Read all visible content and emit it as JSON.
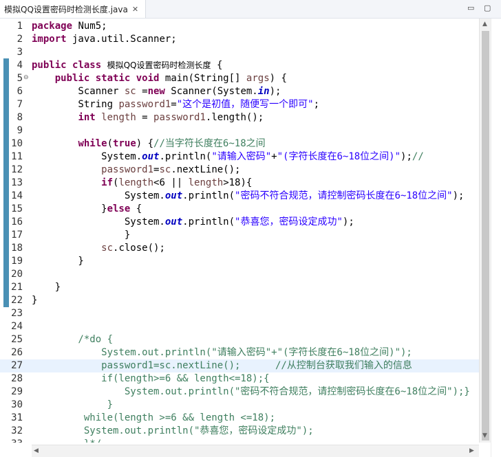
{
  "tab": {
    "title": "模拟QQ设置密码时检测长度.java",
    "close_glyph": "✕"
  },
  "window_controls": {
    "minimize": "▭",
    "maximize": "▢"
  },
  "editor": {
    "current_line": 27,
    "lines": [
      {
        "n": "1",
        "tokens": [
          {
            "t": "package",
            "c": "kw"
          },
          {
            "t": " Num5;"
          }
        ]
      },
      {
        "n": "2",
        "tokens": [
          {
            "t": "import",
            "c": "kw"
          },
          {
            "t": " java.util.Scanner;"
          }
        ]
      },
      {
        "n": "3",
        "tokens": []
      },
      {
        "n": "4",
        "tokens": [
          {
            "t": "public",
            "c": "kw"
          },
          {
            "t": " "
          },
          {
            "t": "class",
            "c": "kw"
          },
          {
            "t": " "
          },
          {
            "t": "模拟QQ设置密码时检测长度",
            "c": "cjk"
          },
          {
            "t": " {"
          }
        ]
      },
      {
        "n": "5",
        "fold": "⊖",
        "tokens": [
          {
            "t": "    "
          },
          {
            "t": "public",
            "c": "kw"
          },
          {
            "t": " "
          },
          {
            "t": "static",
            "c": "kw"
          },
          {
            "t": " "
          },
          {
            "t": "void",
            "c": "kw"
          },
          {
            "t": " main(String[] "
          },
          {
            "t": "args",
            "c": "var"
          },
          {
            "t": ") {"
          }
        ]
      },
      {
        "n": "6",
        "tokens": [
          {
            "t": "        Scanner "
          },
          {
            "t": "sc",
            "c": "var"
          },
          {
            "t": " ="
          },
          {
            "t": "new",
            "c": "kw"
          },
          {
            "t": " Scanner(System."
          },
          {
            "t": "in",
            "c": "fld"
          },
          {
            "t": ");"
          }
        ]
      },
      {
        "n": "7",
        "tokens": [
          {
            "t": "        String "
          },
          {
            "t": "password1",
            "c": "var"
          },
          {
            "t": "="
          },
          {
            "t": "\"这个是初值，随便写一个即可\"",
            "c": "str"
          },
          {
            "t": ";"
          }
        ]
      },
      {
        "n": "8",
        "tokens": [
          {
            "t": "        "
          },
          {
            "t": "int",
            "c": "kw"
          },
          {
            "t": " "
          },
          {
            "t": "length",
            "c": "var"
          },
          {
            "t": " = "
          },
          {
            "t": "password1",
            "c": "var"
          },
          {
            "t": ".length();"
          }
        ]
      },
      {
        "n": "9",
        "tokens": []
      },
      {
        "n": "10",
        "tokens": [
          {
            "t": "        "
          },
          {
            "t": "while",
            "c": "kw"
          },
          {
            "t": "("
          },
          {
            "t": "true",
            "c": "kw"
          },
          {
            "t": ") {"
          },
          {
            "t": "//当字符长度在6~18之间",
            "c": "cmt"
          }
        ]
      },
      {
        "n": "11",
        "tokens": [
          {
            "t": "            System."
          },
          {
            "t": "out",
            "c": "fld"
          },
          {
            "t": ".println("
          },
          {
            "t": "\"请输入密码\"",
            "c": "str"
          },
          {
            "t": "+"
          },
          {
            "t": "\"(字符长度在6~18位之间)\"",
            "c": "str"
          },
          {
            "t": ");"
          },
          {
            "t": "//",
            "c": "cmt"
          }
        ]
      },
      {
        "n": "12",
        "tokens": [
          {
            "t": "            "
          },
          {
            "t": "password1",
            "c": "var"
          },
          {
            "t": "="
          },
          {
            "t": "sc",
            "c": "var"
          },
          {
            "t": ".nextLine();"
          }
        ]
      },
      {
        "n": "13",
        "tokens": [
          {
            "t": "            "
          },
          {
            "t": "if",
            "c": "kw"
          },
          {
            "t": "("
          },
          {
            "t": "length",
            "c": "var"
          },
          {
            "t": "<6 || "
          },
          {
            "t": "length",
            "c": "var"
          },
          {
            "t": ">18){"
          }
        ]
      },
      {
        "n": "14",
        "tokens": [
          {
            "t": "                System."
          },
          {
            "t": "out",
            "c": "fld"
          },
          {
            "t": ".println("
          },
          {
            "t": "\"密码不符合规范，请控制密码长度在6~18位之间\"",
            "c": "str"
          },
          {
            "t": ");"
          }
        ]
      },
      {
        "n": "15",
        "tokens": [
          {
            "t": "            }"
          },
          {
            "t": "else",
            "c": "kw"
          },
          {
            "t": " {"
          }
        ]
      },
      {
        "n": "16",
        "tokens": [
          {
            "t": "                System."
          },
          {
            "t": "out",
            "c": "fld"
          },
          {
            "t": ".println("
          },
          {
            "t": "\"恭喜您，密码设定成功\"",
            "c": "str"
          },
          {
            "t": ");"
          }
        ]
      },
      {
        "n": "17",
        "tokens": [
          {
            "t": "                }"
          }
        ]
      },
      {
        "n": "18",
        "tokens": [
          {
            "t": "            "
          },
          {
            "t": "sc",
            "c": "var"
          },
          {
            "t": ".close();"
          }
        ]
      },
      {
        "n": "19",
        "tokens": [
          {
            "t": "        }"
          }
        ]
      },
      {
        "n": "20",
        "tokens": []
      },
      {
        "n": "21",
        "tokens": [
          {
            "t": "    }"
          }
        ]
      },
      {
        "n": "22",
        "tokens": [
          {
            "t": "}"
          }
        ]
      },
      {
        "n": "23",
        "tokens": []
      },
      {
        "n": "24",
        "tokens": []
      },
      {
        "n": "25",
        "tokens": [
          {
            "t": "        /*do {",
            "c": "cmt"
          }
        ]
      },
      {
        "n": "26",
        "tokens": [
          {
            "t": "            System.out.println(\"请输入密码\"+\"(字符长度在6~18位之间)\");",
            "c": "cmt"
          }
        ]
      },
      {
        "n": "27",
        "tokens": [
          {
            "t": "            password1=sc.nextLine();      //从控制台获取我们输入的信息",
            "c": "cmt"
          }
        ]
      },
      {
        "n": "28",
        "tokens": [
          {
            "t": "            if(length>=6 && length<=18);{",
            "c": "cmt"
          }
        ]
      },
      {
        "n": "29",
        "tokens": [
          {
            "t": "                System.out.println(\"密码不符合规范，请控制密码长度在6~18位之间\");}",
            "c": "cmt"
          }
        ]
      },
      {
        "n": "30",
        "tokens": [
          {
            "t": "             }",
            "c": "cmt"
          }
        ]
      },
      {
        "n": "31",
        "tokens": [
          {
            "t": "         while(length >=6 && length <=18);",
            "c": "cmt"
          }
        ]
      },
      {
        "n": "32",
        "tokens": [
          {
            "t": "         System.out.println(\"恭喜您，密码设定成功\");",
            "c": "cmt"
          }
        ]
      },
      {
        "n": "33",
        "tokens": [
          {
            "t": "         }*/",
            "c": "cmt"
          }
        ]
      }
    ]
  },
  "scrollbars": {
    "up": "▲",
    "down": "▼",
    "left": "◀",
    "right": "▶"
  }
}
